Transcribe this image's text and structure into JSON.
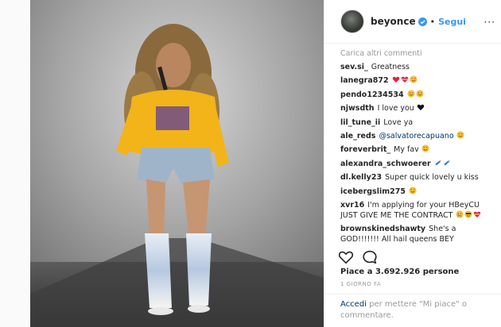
{
  "post": {
    "username": "beyonce",
    "follow_label": "Segui",
    "dot": "•"
  },
  "colors": {
    "link_blue": "#3897f0",
    "verified_blue": "#3897f0",
    "muted": "#999999",
    "text": "#262626",
    "hoodie_yellow": "#f2b418"
  },
  "comments": {
    "load_more": "Carica altri commenti",
    "items": [
      {
        "author": "sev.si_",
        "text": "Greatness",
        "emojis": []
      },
      {
        "author": "lanegra872",
        "text": "",
        "emojis": [
          "red-heart",
          "heart-with-ribbon",
          "smiling-face-with-heart-eyes"
        ]
      },
      {
        "author": "pendo1234534",
        "text": "",
        "emojis": [
          "smiling-face",
          "smiling-face"
        ]
      },
      {
        "author": "njwsdth",
        "text": "I love you",
        "emojis": [
          "black-heart"
        ]
      },
      {
        "author": "lil_tune_ii",
        "text": "Love ya",
        "emojis": []
      },
      {
        "author": "ale_reds",
        "text": "@salvatorecapuano",
        "emojis": [
          "smiling-face-with-heart-eyes"
        ]
      },
      {
        "author": "foreverbrit_",
        "text": "My fav",
        "emojis": [
          "smiling-face-with-heart-eyes"
        ]
      },
      {
        "author": "alexandra_schwoerer",
        "text": "",
        "emojis": [
          "syringe",
          "syringe"
        ]
      },
      {
        "author": "dl.kelly23",
        "text": "Super quick lovely u kiss",
        "emojis": []
      },
      {
        "author": "icebergslim275",
        "text": "",
        "emojis": [
          "smiling-face-with-heart-eyes"
        ]
      },
      {
        "author": "xvr16",
        "text": "I'm applying for your HBeyCU JUST GIVE ME THE CONTRACT",
        "emojis": [
          "crying-face",
          "smiling-face-with-sunglasses",
          "heart-with-ribbon"
        ]
      },
      {
        "author": "brownskinedshawty",
        "text": "She's a GOD!!!!!!! All hail queens BEY",
        "emojis": []
      }
    ]
  },
  "actions": {
    "like_icon": "heart-outline-icon",
    "comment_icon": "speech-bubble-icon"
  },
  "likes": {
    "prefix": "Piace a",
    "count": "3.692.926",
    "suffix": "persone"
  },
  "timestamp": "1 GIORNO FA",
  "login": {
    "link": "Accedi",
    "rest": "per mettere \"Mi piace\" o commentare."
  }
}
